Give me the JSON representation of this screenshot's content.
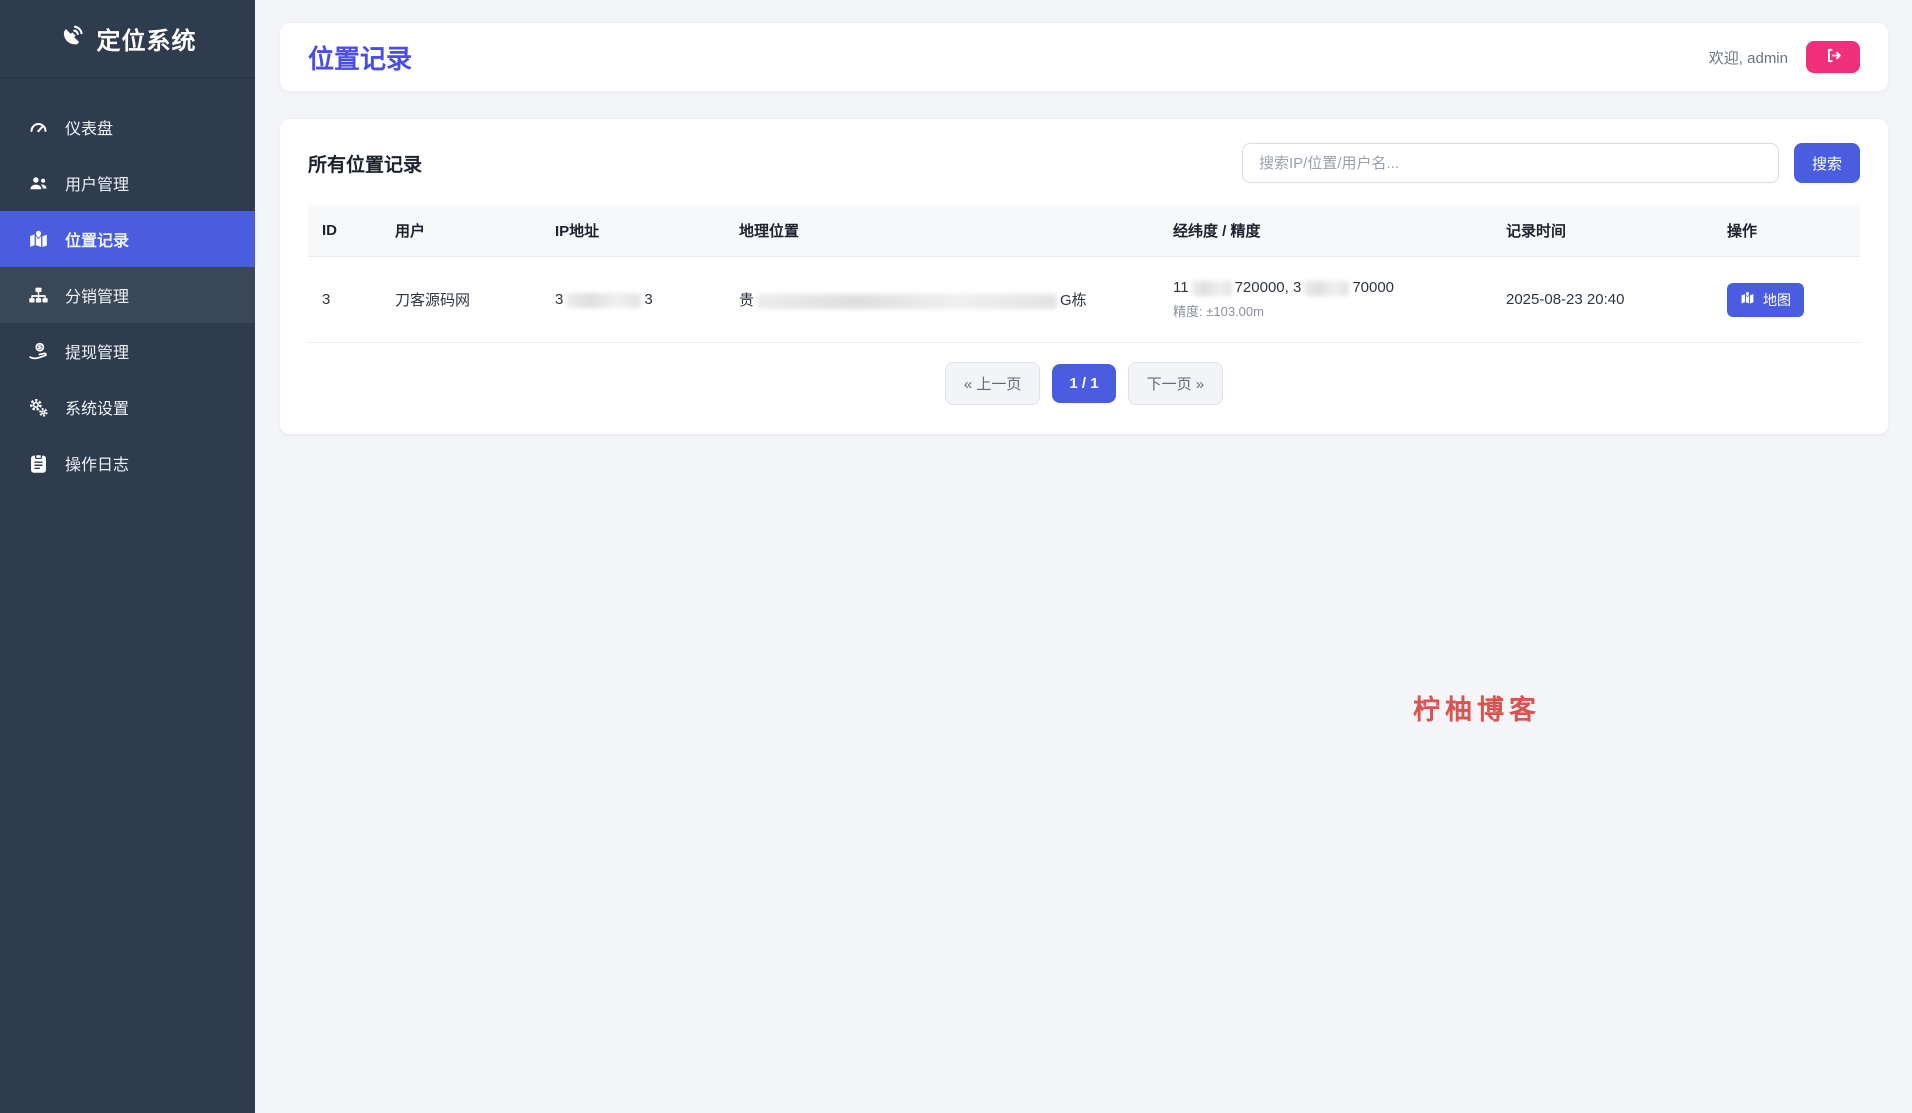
{
  "app": {
    "title": "定位系统"
  },
  "sidebar": {
    "items": [
      {
        "label": "仪表盘",
        "icon": "gauge-icon",
        "active": false
      },
      {
        "label": "用户管理",
        "icon": "users-icon",
        "active": false
      },
      {
        "label": "位置记录",
        "icon": "map-marker-icon",
        "active": true
      },
      {
        "label": "分销管理",
        "icon": "sitemap-icon",
        "active": false
      },
      {
        "label": "提现管理",
        "icon": "hand-coin-icon",
        "active": false
      },
      {
        "label": "系统设置",
        "icon": "gears-icon",
        "active": false
      },
      {
        "label": "操作日志",
        "icon": "clipboard-icon",
        "active": false
      }
    ]
  },
  "header": {
    "page_title": "位置记录",
    "welcome": "欢迎, admin"
  },
  "panel": {
    "title": "所有位置记录",
    "search": {
      "placeholder": "搜索IP/位置/用户名...",
      "button": "搜索"
    },
    "table": {
      "columns": [
        "ID",
        "用户",
        "IP地址",
        "地理位置",
        "经纬度 / 精度",
        "记录时间",
        "操作"
      ],
      "rows": [
        {
          "id": "3",
          "user": "刀客源码网",
          "ip_prefix": "3",
          "ip_suffix": "3",
          "location_prefix": "贵",
          "location_suffix": "G栋",
          "coord_seg1": "11",
          "coord_seg2": "720000, 3",
          "coord_seg3": "70000",
          "accuracy": "精度: ±103.00m",
          "time": "2025-08-23 20:40",
          "map_button": "地图"
        }
      ]
    },
    "pagination": {
      "prev": "« 上一页",
      "current": "1 / 1",
      "next": "下一页 »"
    }
  },
  "watermark": "柠柚博客",
  "colors": {
    "sidebar_bg": "#2e3c4e",
    "accent_blue": "#4a5de0",
    "title_blue": "#4b4ee4",
    "logout_pink": "#f0307d",
    "watermark_red": "#db5350",
    "content_bg": "#f4f5f9"
  }
}
